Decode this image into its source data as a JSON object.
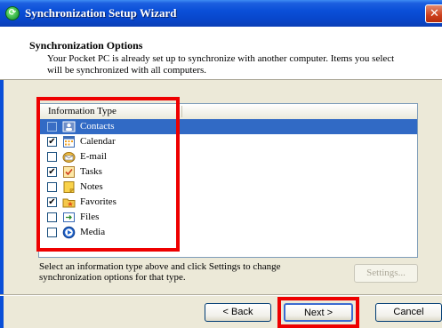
{
  "window": {
    "title": "Synchronization Setup Wizard",
    "close_symbol": "✕"
  },
  "header": {
    "title": "Synchronization Options",
    "description": "Your Pocket PC is already set up to synchronize with another computer. Items you select will be synchronized with all computers."
  },
  "list": {
    "column_header": "Information Type",
    "items": [
      {
        "label": "Contacts",
        "checked": false,
        "selected": true,
        "icon": "contacts-icon"
      },
      {
        "label": "Calendar",
        "checked": true,
        "selected": false,
        "icon": "calendar-icon"
      },
      {
        "label": "E-mail",
        "checked": false,
        "selected": false,
        "icon": "email-icon"
      },
      {
        "label": "Tasks",
        "checked": true,
        "selected": false,
        "icon": "tasks-icon"
      },
      {
        "label": "Notes",
        "checked": false,
        "selected": false,
        "icon": "notes-icon"
      },
      {
        "label": "Favorites",
        "checked": true,
        "selected": false,
        "icon": "favorites-icon"
      },
      {
        "label": "Files",
        "checked": false,
        "selected": false,
        "icon": "files-icon"
      },
      {
        "label": "Media",
        "checked": false,
        "selected": false,
        "icon": "media-icon"
      }
    ],
    "check_mark": "✔"
  },
  "hint": "Select an information type above and click Settings to change synchronization options for that type.",
  "buttons": {
    "settings": "Settings...",
    "back": "< Back",
    "next": "Next >",
    "cancel": "Cancel"
  },
  "colors": {
    "highlight_box": "#ee0000",
    "selection": "#316ac5",
    "titlebar": "#0a4fd8"
  }
}
